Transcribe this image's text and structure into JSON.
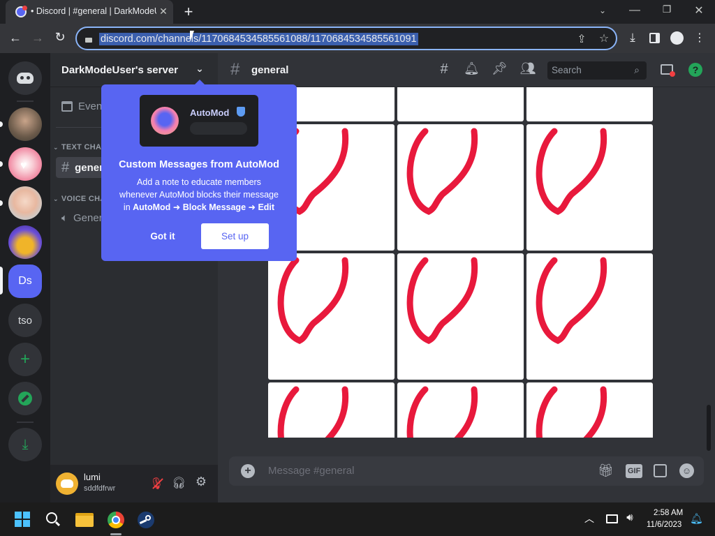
{
  "browser": {
    "tab_title": "• Discord | #general | DarkModeUser's server",
    "new_tab_label": "+",
    "url": "discord.com/channels/1170684534585561088/1170684534585561091"
  },
  "guilds": {
    "items": [
      {
        "label": "Ds"
      },
      {
        "label": "tso"
      }
    ]
  },
  "channels": {
    "server_name": "DarkModeUser's server",
    "events_label": "Events",
    "text_category": "TEXT CHANNELS",
    "text_channel": "general",
    "voice_category": "VOICE CHANNELS",
    "voice_channel": "General"
  },
  "user": {
    "name": "lumi",
    "tag": "sddfdfrwr"
  },
  "chat": {
    "channel_name": "general",
    "search_placeholder": "Search",
    "message_placeholder": "Message #general",
    "gif_label": "GIF"
  },
  "popup": {
    "automod_label": "AutoMod",
    "title": "Custom Messages from AutoMod",
    "body_line1": "Add a note to educate members",
    "body_line2": "whenever AutoMod blocks their message",
    "body_prefix": "in",
    "body_bold": "AutoMod ➜ Block Message ➜ Edit",
    "got_it": "Got it",
    "set_up": "Set up"
  },
  "taskbar": {
    "time": "2:58 AM",
    "date": "11/6/2023"
  },
  "colors": {
    "blurple": "#5865f2",
    "green": "#23a559",
    "heart_red": "#e8193c"
  }
}
